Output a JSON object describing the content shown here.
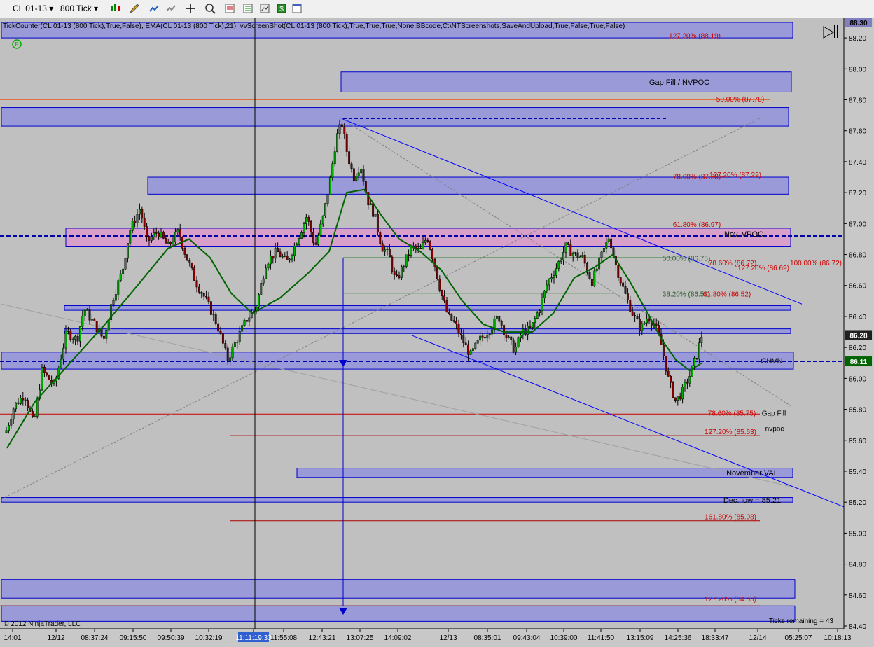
{
  "toolbar": {
    "instrument": "CL 01-13",
    "interval": "800 Tick",
    "icons": [
      "candlestick-icon",
      "pencil-icon",
      "add-indicator-icon",
      "strategy-icon",
      "crosshair-icon",
      "zoom-icon",
      "properties-icon",
      "data-box-icon",
      "chart-trader-icon",
      "dollar-icon",
      "window-icon"
    ]
  },
  "indicator_line": "TickCounter(CL 01-13 (800 Tick),True,False), EMA(CL 01-13 (800 Tick),21), vvScreenShot(CL 01-13 (800 Tick),True,True,True,None,BBcode,C:\\NTScreenshots,SaveAndUpload,True,False,True,False)",
  "copyright": "© 2012 NinjaTrader, LLC",
  "ticks_remaining": "Ticks remaining = 43",
  "colors": {
    "background": "#c0c0c0",
    "zone_fill": "#9a9ad8",
    "zone_border": "#0000cc",
    "pink_zone": "#d8a0c8",
    "ema": "#006400",
    "candle_down": "#8b0000",
    "fib_red": "#cc0000",
    "trend": "#0000ff"
  },
  "chart_data": {
    "type": "candlestick",
    "instrument": "CL 01-13",
    "interval": "800 Tick",
    "ylim": [
      84.4,
      88.3
    ],
    "yticks": [
      "88.20",
      "88.00",
      "87.80",
      "87.60",
      "87.40",
      "87.20",
      "87.00",
      "86.80",
      "86.60",
      "86.40",
      "86.20",
      "86.00",
      "85.80",
      "85.60",
      "85.40",
      "85.20",
      "85.00",
      "84.80",
      "84.60",
      "84.40"
    ],
    "xticks": [
      "14:01",
      "12/12",
      "08:37:24",
      "09:15:50",
      "09:50:39",
      "10:32:19",
      "11:11:19:33",
      "11:55:08",
      "12:43:21",
      "13:07:25",
      "14:09:02",
      "12/13",
      "08:35:01",
      "09:43:04",
      "10:39:00",
      "11:41:50",
      "13:15:09",
      "14:25:36",
      "18:33:47",
      "12/14",
      "05:25:07",
      "10:18:13"
    ],
    "last_price": "86.28",
    "high_label": "88.30",
    "marker_label": "86.11",
    "price_path": [
      [
        0,
        85.3
      ],
      [
        8,
        85.65
      ],
      [
        20,
        85.82
      ],
      [
        35,
        85.9
      ],
      [
        48,
        85.7
      ],
      [
        60,
        86.05
      ],
      [
        78,
        85.95
      ],
      [
        95,
        86.3
      ],
      [
        110,
        86.25
      ],
      [
        120,
        86.45
      ],
      [
        135,
        86.35
      ],
      [
        148,
        86.25
      ],
      [
        160,
        86.5
      ],
      [
        175,
        86.7
      ],
      [
        185,
        86.95
      ],
      [
        200,
        87.1
      ],
      [
        210,
        86.88
      ],
      [
        225,
        86.95
      ],
      [
        240,
        86.85
      ],
      [
        255,
        86.95
      ],
      [
        265,
        86.8
      ],
      [
        280,
        86.62
      ],
      [
        295,
        86.5
      ],
      [
        310,
        86.35
      ],
      [
        325,
        86.12
      ],
      [
        338,
        86.25
      ],
      [
        352,
        86.38
      ],
      [
        365,
        86.45
      ],
      [
        380,
        86.75
      ],
      [
        395,
        86.82
      ],
      [
        410,
        86.75
      ],
      [
        425,
        86.9
      ],
      [
        438,
        87.05
      ],
      [
        450,
        86.85
      ],
      [
        462,
        87.05
      ],
      [
        472,
        87.3
      ],
      [
        480,
        87.55
      ],
      [
        488,
        87.65
      ],
      [
        496,
        87.45
      ],
      [
        505,
        87.3
      ],
      [
        515,
        87.38
      ],
      [
        525,
        87.15
      ],
      [
        535,
        87.05
      ],
      [
        545,
        86.85
      ],
      [
        555,
        86.8
      ],
      [
        565,
        86.62
      ],
      [
        575,
        86.72
      ],
      [
        588,
        86.85
      ],
      [
        600,
        86.82
      ],
      [
        610,
        86.92
      ],
      [
        620,
        86.75
      ],
      [
        630,
        86.55
      ],
      [
        640,
        86.4
      ],
      [
        650,
        86.35
      ],
      [
        660,
        86.25
      ],
      [
        672,
        86.15
      ],
      [
        685,
        86.25
      ],
      [
        700,
        86.32
      ],
      [
        712,
        86.4
      ],
      [
        722,
        86.28
      ],
      [
        735,
        86.18
      ],
      [
        745,
        86.3
      ],
      [
        758,
        86.32
      ],
      [
        770,
        86.45
      ],
      [
        782,
        86.62
      ],
      [
        795,
        86.72
      ],
      [
        808,
        86.85
      ],
      [
        820,
        86.8
      ],
      [
        832,
        86.78
      ],
      [
        845,
        86.62
      ],
      [
        858,
        86.78
      ],
      [
        870,
        86.92
      ],
      [
        880,
        86.72
      ],
      [
        892,
        86.55
      ],
      [
        905,
        86.4
      ],
      [
        915,
        86.32
      ],
      [
        925,
        86.4
      ],
      [
        935,
        86.35
      ],
      [
        945,
        86.2
      ],
      [
        955,
        85.98
      ],
      [
        965,
        85.85
      ],
      [
        975,
        85.92
      ],
      [
        985,
        86.02
      ],
      [
        995,
        86.15
      ],
      [
        1002,
        86.28
      ]
    ],
    "ema_path": [
      [
        10,
        85.55
      ],
      [
        50,
        85.85
      ],
      [
        100,
        86.1
      ],
      [
        150,
        86.35
      ],
      [
        200,
        86.62
      ],
      [
        240,
        86.84
      ],
      [
        270,
        86.9
      ],
      [
        300,
        86.78
      ],
      [
        330,
        86.55
      ],
      [
        360,
        86.42
      ],
      [
        400,
        86.52
      ],
      [
        440,
        86.68
      ],
      [
        470,
        86.82
      ],
      [
        495,
        87.2
      ],
      [
        520,
        87.22
      ],
      [
        545,
        87.05
      ],
      [
        570,
        86.9
      ],
      [
        600,
        86.82
      ],
      [
        630,
        86.7
      ],
      [
        660,
        86.5
      ],
      [
        690,
        86.35
      ],
      [
        720,
        86.3
      ],
      [
        760,
        86.3
      ],
      [
        790,
        86.42
      ],
      [
        820,
        86.65
      ],
      [
        850,
        86.72
      ],
      [
        875,
        86.8
      ],
      [
        900,
        86.62
      ],
      [
        925,
        86.42
      ],
      [
        945,
        86.25
      ],
      [
        965,
        86.12
      ],
      [
        985,
        86.05
      ],
      [
        1002,
        86.1
      ]
    ],
    "zones": [
      {
        "y1": 88.3,
        "y2": 88.2,
        "x1": 2,
        "x2": 1132,
        "label": ""
      },
      {
        "y1": 87.98,
        "y2": 87.85,
        "x1": 487,
        "x2": 1130,
        "label": "Gap Fill / NVPOC"
      },
      {
        "y1": 87.75,
        "y2": 87.63,
        "x1": 2,
        "x2": 1126,
        "label": ""
      },
      {
        "y1": 87.3,
        "y2": 87.19,
        "x1": 211,
        "x2": 1126,
        "label": ""
      },
      {
        "y1": 86.47,
        "y2": 86.44,
        "x1": 92,
        "x2": 1129,
        "label": ""
      },
      {
        "y1": 86.32,
        "y2": 86.29,
        "x1": 92,
        "x2": 1129,
        "label": ""
      },
      {
        "y1": 86.17,
        "y2": 86.06,
        "x1": 2,
        "x2": 1133,
        "label": "CHVN"
      },
      {
        "y1": 85.42,
        "y2": 85.36,
        "x1": 424,
        "x2": 1132,
        "label": "November VAL"
      },
      {
        "y1": 85.23,
        "y2": 85.2,
        "x1": 2,
        "x2": 1132,
        "label": "Dec. low = 85.21"
      },
      {
        "y1": 84.7,
        "y2": 84.58,
        "x1": 2,
        "x2": 1135,
        "label": ""
      },
      {
        "y1": 84.53,
        "y2": 84.43,
        "x1": 2,
        "x2": 1135,
        "label": ""
      }
    ],
    "pink_zone": {
      "y1": 86.97,
      "y2": 86.85,
      "x1": 94,
      "x2": 1129,
      "label": "Nov. VPOC"
    },
    "fib_labels": [
      {
        "text": "127.20% (88.19)",
        "y": 88.19
      },
      {
        "text": "50.00% (87.78)",
        "y": 87.78
      },
      {
        "text": "78.60% (87.28)",
        "y": 87.28
      },
      {
        "text": "127.20% (87.29)",
        "y": 87.29
      },
      {
        "text": "61.80% (86.97)",
        "y": 86.97
      },
      {
        "text": "50.00% (86.75)",
        "y": 86.75
      },
      {
        "text": "78.60% (86.72)",
        "y": 86.72
      },
      {
        "text": "100.00% (86.72)",
        "y": 86.72
      },
      {
        "text": "127.20% (86.69)",
        "y": 86.69
      },
      {
        "text": "38.20% (86.52)",
        "y": 86.52
      },
      {
        "text": "61.80% (86.52)",
        "y": 86.52
      },
      {
        "text": "78.60% (85.75)",
        "y": 85.75
      },
      {
        "text": "Gap Fill",
        "y": 85.75
      },
      {
        "text": "127.20% (85.63)",
        "y": 85.63
      },
      {
        "text": "nvpoc",
        "y": 85.65
      },
      {
        "text": "161.80% (85.08)",
        "y": 85.08
      },
      {
        "text": "127.20% (84.55)",
        "y": 84.55
      }
    ]
  }
}
